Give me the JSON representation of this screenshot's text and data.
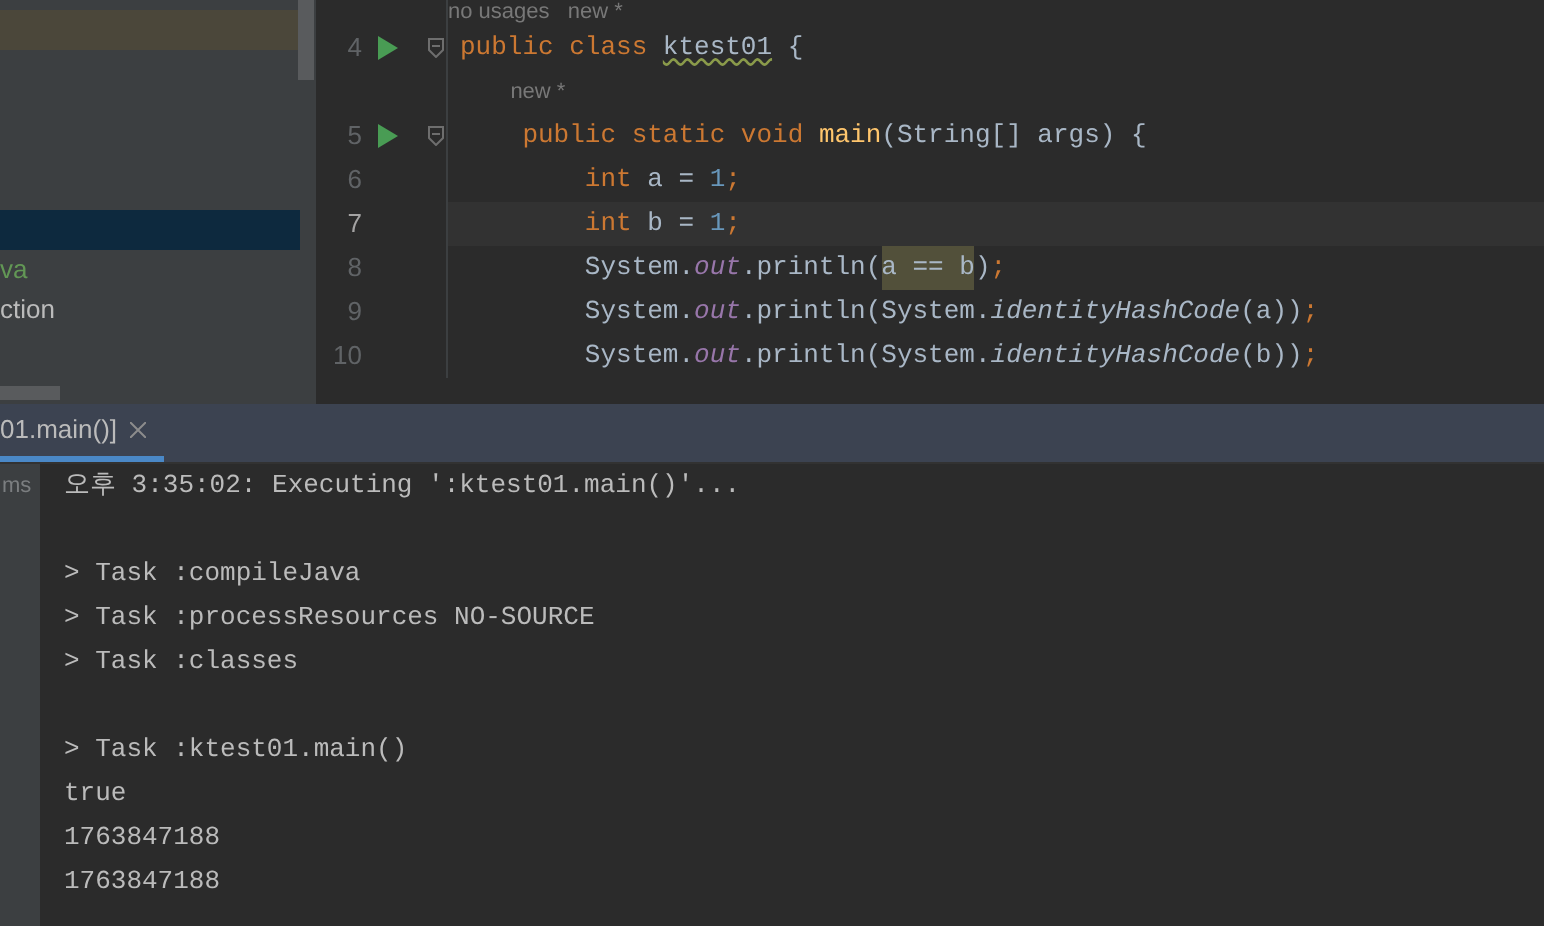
{
  "project_tree": {
    "items": [
      {
        "kind": "highlighted",
        "selected": false
      },
      {
        "kind": "plain",
        "selected": true
      },
      {
        "kind": "plain",
        "label": "va",
        "color": "#629755",
        "selected": false
      },
      {
        "kind": "plain",
        "label": "ction",
        "color": "#bbbbbb",
        "selected": false
      }
    ]
  },
  "editor": {
    "lines": [
      {
        "kind": "hint",
        "text": "no usages   new *"
      },
      {
        "kind": "code",
        "number": "4",
        "current": false,
        "run_icon": true,
        "fold": true,
        "tokens": [
          {
            "text": "public class ",
            "kind": "keyword"
          },
          {
            "text": "ktest01",
            "kind": "warning"
          },
          {
            "text": " {",
            "kind": "plain"
          }
        ]
      },
      {
        "kind": "hint",
        "text": "new *"
      },
      {
        "kind": "code",
        "number": "5",
        "current": false,
        "run_icon": true,
        "fold": true,
        "tokens": [
          {
            "text": "    public static void ",
            "kind": "keyword"
          },
          {
            "text": "main",
            "kind": "method"
          },
          {
            "text": "(String[] args) {",
            "kind": "plain"
          }
        ]
      },
      {
        "kind": "code",
        "number": "6",
        "current": false,
        "run_icon": false,
        "fold": false,
        "tokens": [
          {
            "text": "        int ",
            "kind": "keyword"
          },
          {
            "text": "a = ",
            "kind": "plain"
          },
          {
            "text": "1",
            "kind": "number"
          },
          {
            "text": ";",
            "kind": "keyword"
          }
        ]
      },
      {
        "kind": "code",
        "number": "7",
        "current": true,
        "run_icon": false,
        "fold": false,
        "tokens": [
          {
            "text": "        int ",
            "kind": "keyword"
          },
          {
            "text": "b = ",
            "kind": "plain"
          },
          {
            "text": "1",
            "kind": "number"
          },
          {
            "text": ";",
            "kind": "keyword"
          }
        ]
      },
      {
        "kind": "code",
        "number": "8",
        "current": false,
        "run_icon": false,
        "fold": false,
        "tokens": [
          {
            "text": "        System.",
            "kind": "plain"
          },
          {
            "text": "out",
            "kind": "static"
          },
          {
            "text": ".println(",
            "kind": "plain"
          },
          {
            "text": "a == b",
            "kind": "usage"
          },
          {
            "text": ")",
            "kind": "plain"
          },
          {
            "text": ";",
            "kind": "keyword"
          }
        ]
      },
      {
        "kind": "code",
        "number": "9",
        "current": false,
        "run_icon": false,
        "fold": false,
        "tokens": [
          {
            "text": "        System.",
            "kind": "plain"
          },
          {
            "text": "out",
            "kind": "static"
          },
          {
            "text": ".println(System.",
            "kind": "plain"
          },
          {
            "text": "identityHashCode",
            "kind": "static_method"
          },
          {
            "text": "(a))",
            "kind": "plain"
          },
          {
            "text": ";",
            "kind": "keyword"
          }
        ]
      },
      {
        "kind": "code",
        "number": "10",
        "current": false,
        "run_icon": false,
        "fold": false,
        "tokens": [
          {
            "text": "        System.",
            "kind": "plain"
          },
          {
            "text": "out",
            "kind": "static"
          },
          {
            "text": ".println(System.",
            "kind": "plain"
          },
          {
            "text": "identityHashCode",
            "kind": "static_method"
          },
          {
            "text": "(b))",
            "kind": "plain"
          },
          {
            "text": ";",
            "kind": "keyword"
          }
        ]
      }
    ]
  },
  "run_panel": {
    "tabs": [
      {
        "label": "01.main()]",
        "selected": true
      }
    ],
    "time_label": "ms",
    "console": [
      [
        "오후 3:35:02: Executing ':ktest01.main()'..."
      ],
      [
        "> Task :compileJava",
        "> Task :processResources NO-SOURCE",
        "> Task :classes"
      ],
      [
        "> Task :ktest01.main()",
        "true",
        "1763847188",
        "1763847188"
      ]
    ]
  }
}
